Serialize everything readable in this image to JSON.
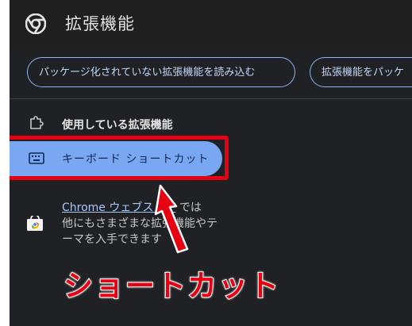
{
  "header": {
    "title": "拡張機能"
  },
  "toolbar": {
    "load_unpacked_label": "パッケージ化されていない拡張機能を読み込む",
    "pack_extension_label": "拡張機能をパッケ"
  },
  "sidebar": {
    "items": [
      {
        "label": "使用している拡張機能",
        "icon": "puzzle-icon"
      },
      {
        "label": "キーボード ショートカット",
        "icon": "keyboard-icon",
        "selected": true
      }
    ]
  },
  "store_promo": {
    "link_text": "Chrome ウェブストア",
    "suffix": " では",
    "rest": "他にもさまざまな拡張機能やテーマを入手できます",
    "icon": "chrome-web-store-icon"
  },
  "annotation": {
    "caption": "ショートカット",
    "highlight_color": "#e60012"
  },
  "colors": {
    "background": "#202124",
    "accent": "#8ab4f8",
    "selected_item": "#7aa7f2"
  }
}
